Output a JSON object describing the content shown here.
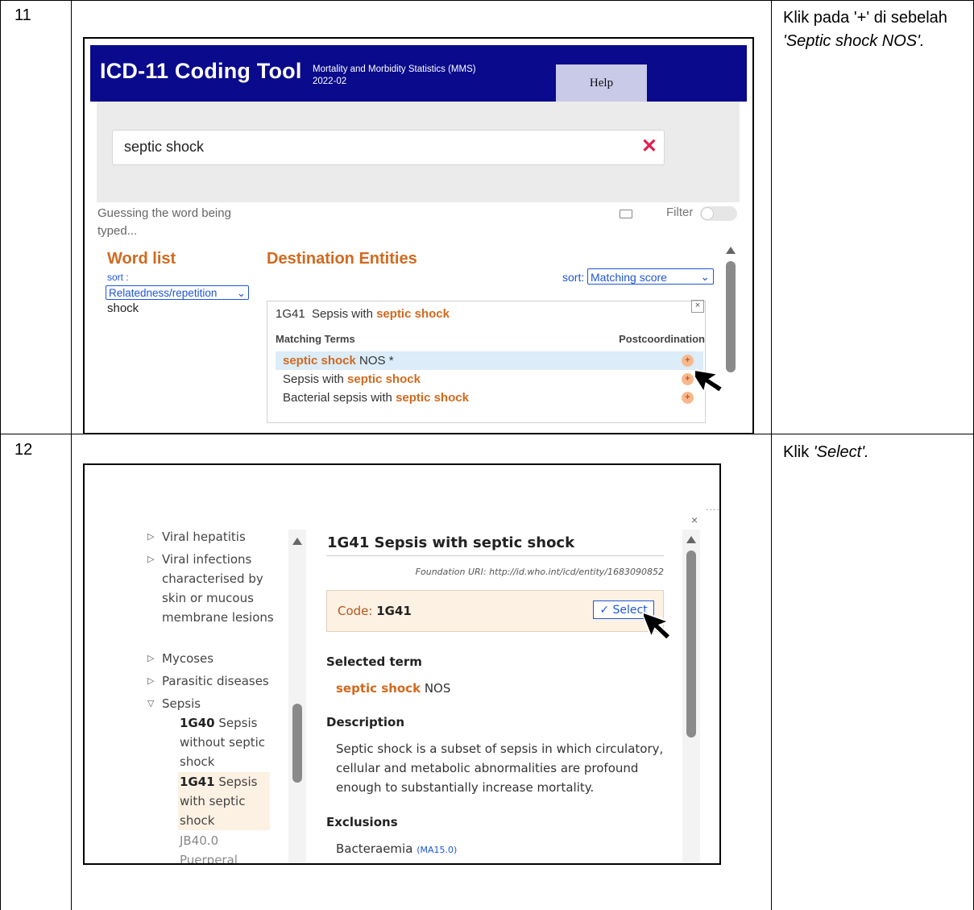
{
  "steps": [
    {
      "number": "11",
      "instruction_prefix": "Klik pada '+' di sebelah ",
      "instruction_italic": "'Septic shock NOS'."
    },
    {
      "number": "12",
      "instruction_prefix": "Klik ",
      "instruction_italic": "'Select'."
    }
  ],
  "shot1": {
    "app_title": "ICD-11 Coding Tool",
    "subtitle_line1": "Mortality and Morbidity Statistics (MMS)",
    "subtitle_line2": "2022-02",
    "help_tab": "Help",
    "search_value": "septic shock",
    "clear_symbol": "✕",
    "guess_text": "Guessing the word being typed...",
    "filter_label": "Filter",
    "word_list": {
      "heading": "Word list",
      "sort_label": "sort :",
      "sort_value": "Relatedness/repetition",
      "items": [
        "shock"
      ]
    },
    "destination": {
      "heading": "Destination Entities",
      "sort_label": "sort:",
      "sort_value": "Matching score",
      "entity_code": "1G41",
      "entity_title_plain": "Sepsis with",
      "entity_title_hl": "septic shock",
      "close_symbol": "×",
      "matching_terms_label": "Matching Terms",
      "postcoordination_label": "Postcoordination",
      "terms": [
        {
          "pre": "",
          "hl": "septic shock",
          "post": " NOS *",
          "selected": true
        },
        {
          "pre": "Sepsis with ",
          "hl": "septic shock",
          "post": "",
          "selected": false
        },
        {
          "pre": "Bacterial sepsis with ",
          "hl": "septic shock",
          "post": "",
          "selected": false
        }
      ],
      "plus_symbol": "+"
    }
  },
  "shot2": {
    "close_symbol": "×",
    "tree": [
      {
        "label": "Viral hepatitis",
        "expander": "▷"
      },
      {
        "label": "Viral infections characterised by skin or mucous membrane lesions",
        "expander": "▷"
      },
      {
        "label": "Mycoses",
        "expander": "▷"
      },
      {
        "label": "Parasitic diseases",
        "expander": "▷"
      },
      {
        "label": "Sepsis",
        "expander": "▽"
      }
    ],
    "tree_children": [
      {
        "code": "1G40",
        "title": "Sepsis without septic shock"
      },
      {
        "code": "1G41",
        "title": "Sepsis with septic shock"
      },
      {
        "code": "JB40.0",
        "title": "Puerperal"
      }
    ],
    "detail_title": "1G41 Sepsis with septic shock",
    "foundation_uri": "Foundation URI: http://id.who.int/icd/entity/1683090852",
    "code_label": "Code:",
    "code_value": "1G41",
    "select_label": "✓ Select",
    "selected_term_heading": "Selected term",
    "selected_term_hl": "septic shock",
    "selected_term_rest": " NOS",
    "description_heading": "Description",
    "description_lines": [
      "Septic shock is a subset of sepsis in which circulatory,",
      "cellular and metabolic abnormalities are profound",
      "enough to substantially increase mortality."
    ],
    "exclusions_heading": "Exclusions",
    "exclusion_item": "Bacteraemia",
    "exclusion_code": "(MA15.0)"
  }
}
